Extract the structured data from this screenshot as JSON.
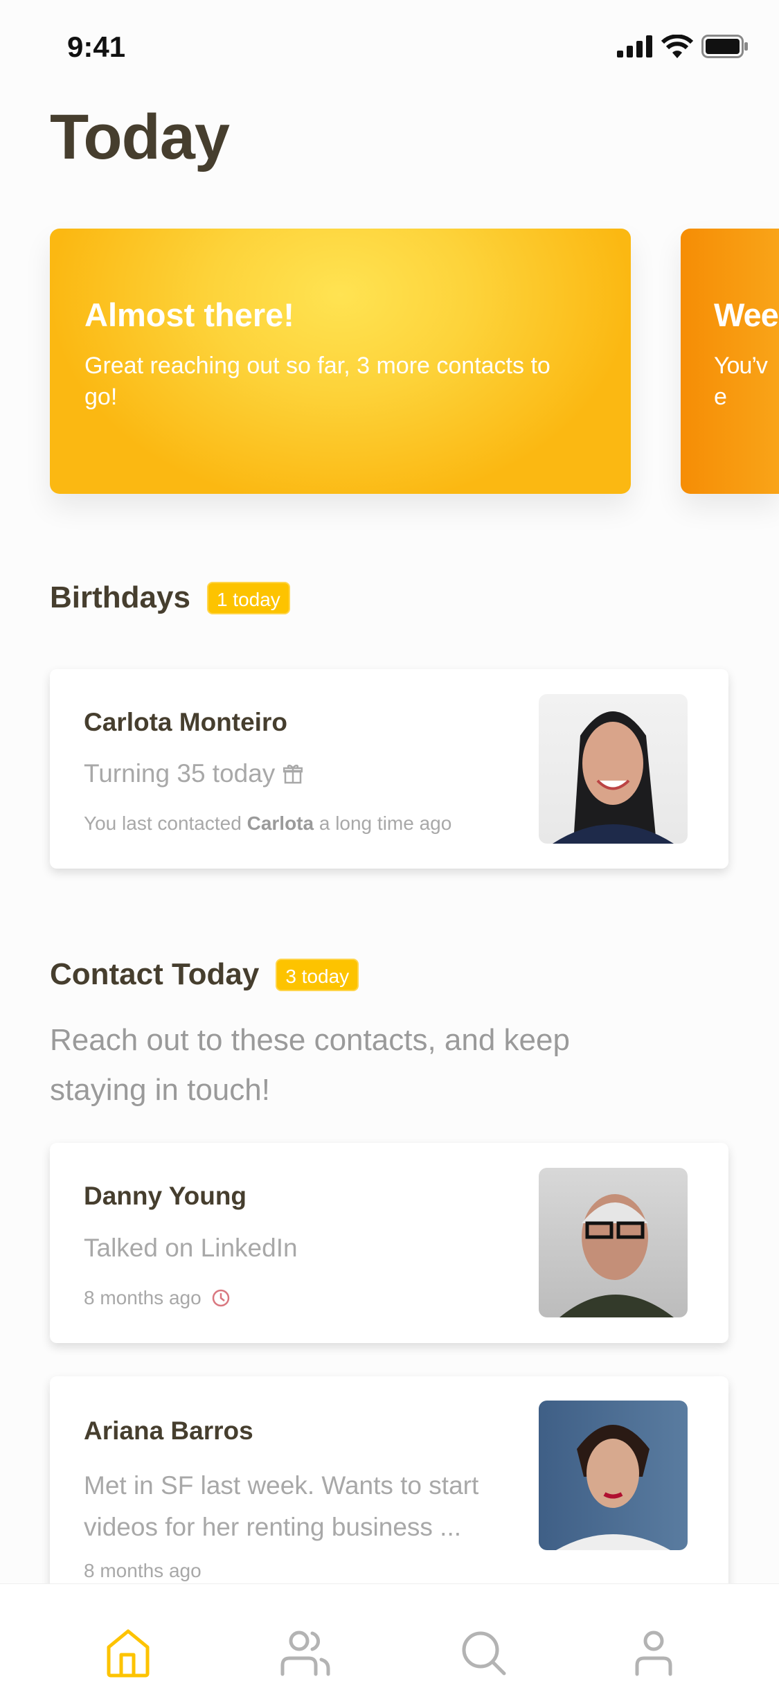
{
  "status_bar": {
    "time": "9:41"
  },
  "page_title": "Today",
  "promos": [
    {
      "title": "Almost there!",
      "text": "Great reaching out so far, 3 more contacts to go!"
    },
    {
      "title": "Wee",
      "text": "You’ve"
    }
  ],
  "birthdays": {
    "heading": "Birthdays",
    "badge": "1 today",
    "contact": {
      "name": "Carlota Monteiro",
      "detail": "Turning 35 today",
      "last_prefix": "You last contacted ",
      "last_name": "Carlota",
      "last_suffix": " a long time ago"
    }
  },
  "contact_today": {
    "heading": "Contact Today",
    "badge": "3 today",
    "description": "Reach out to these contacts, and keep staying in touch!",
    "contacts": [
      {
        "name": "Danny Young",
        "note": "Talked on LinkedIn",
        "time": "8 months ago"
      },
      {
        "name": "Ariana Barros",
        "note": "Met in SF last week. Wants to start videos for her renting business ...",
        "time": "8 months ago"
      }
    ]
  },
  "tabbar": {
    "items": [
      {
        "icon": "home-icon",
        "active": true
      },
      {
        "icon": "contacts-icon"
      },
      {
        "icon": "search-icon"
      },
      {
        "icon": "profile-icon"
      }
    ],
    "active_color": "#fdc300",
    "inactive_color": "#b3b3b3"
  },
  "colors": {
    "accent": "#fdc300",
    "heading": "#463e2e",
    "overdue": "#d9777f"
  }
}
